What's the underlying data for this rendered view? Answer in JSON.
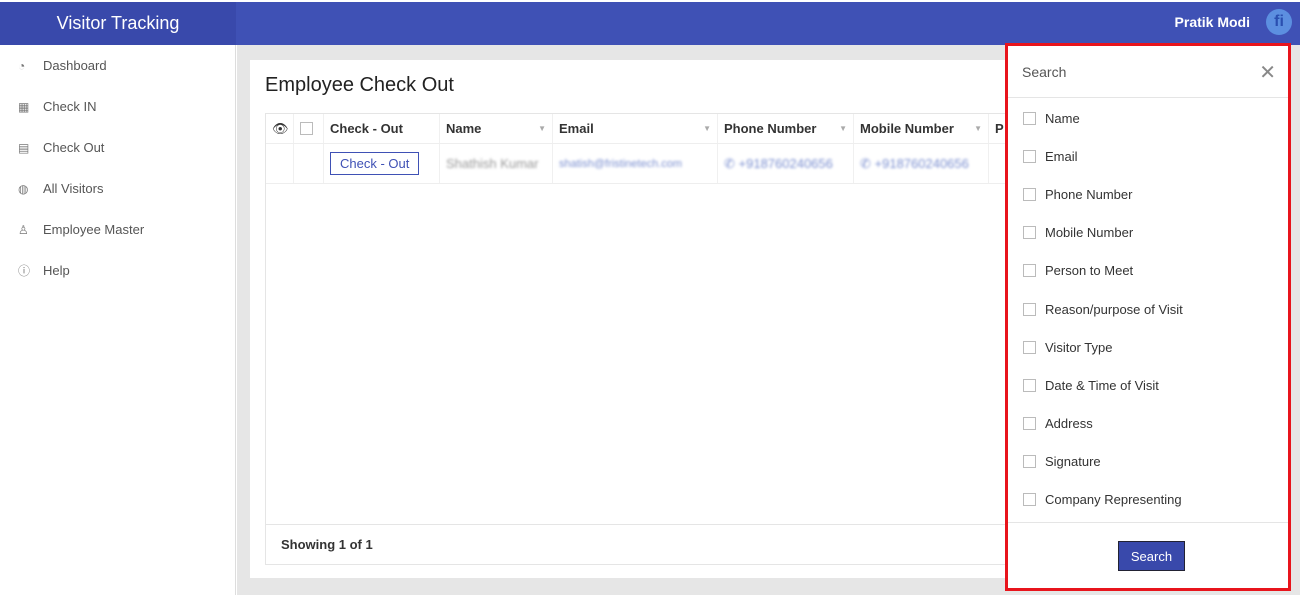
{
  "header": {
    "brand": "Visitor Tracking",
    "user": "Pratik Modi",
    "avatar_letter": "fi"
  },
  "sidebar": {
    "items": [
      {
        "label": "Dashboard",
        "icon": "dashboard-icon",
        "glyph": "◔"
      },
      {
        "label": "Check IN",
        "icon": "checkin-icon",
        "glyph": "▦"
      },
      {
        "label": "Check Out",
        "icon": "checkout-icon",
        "glyph": "▤"
      },
      {
        "label": "All Visitors",
        "icon": "globe-icon",
        "glyph": "◍"
      },
      {
        "label": "Employee Master",
        "icon": "user-icon",
        "glyph": "♙"
      },
      {
        "label": "Help",
        "icon": "info-icon",
        "glyph": "ⓘ"
      }
    ]
  },
  "main": {
    "title": "Employee Check Out",
    "columns": [
      "Check - Out",
      "Name",
      "Email",
      "Phone Number",
      "Mobile Number",
      "P"
    ],
    "rows": [
      {
        "action": "Check - Out",
        "name": "Shathish Kumar",
        "email": "shatish@fristinetech.com",
        "phone": "+918760240656",
        "mobile": "+918760240656"
      }
    ],
    "footer": "Showing 1 of 1"
  },
  "search_panel": {
    "title": "Search",
    "options": [
      "Name",
      "Email",
      "Phone Number",
      "Mobile Number",
      "Person to Meet",
      "Reason/purpose of Visit",
      "Visitor Type",
      "Date & Time of Visit",
      "Address",
      "Signature",
      "Company Representing"
    ],
    "button": "Search",
    "highlight_color": "#e8141c"
  },
  "colors": {
    "primary": "#3f51b5"
  }
}
